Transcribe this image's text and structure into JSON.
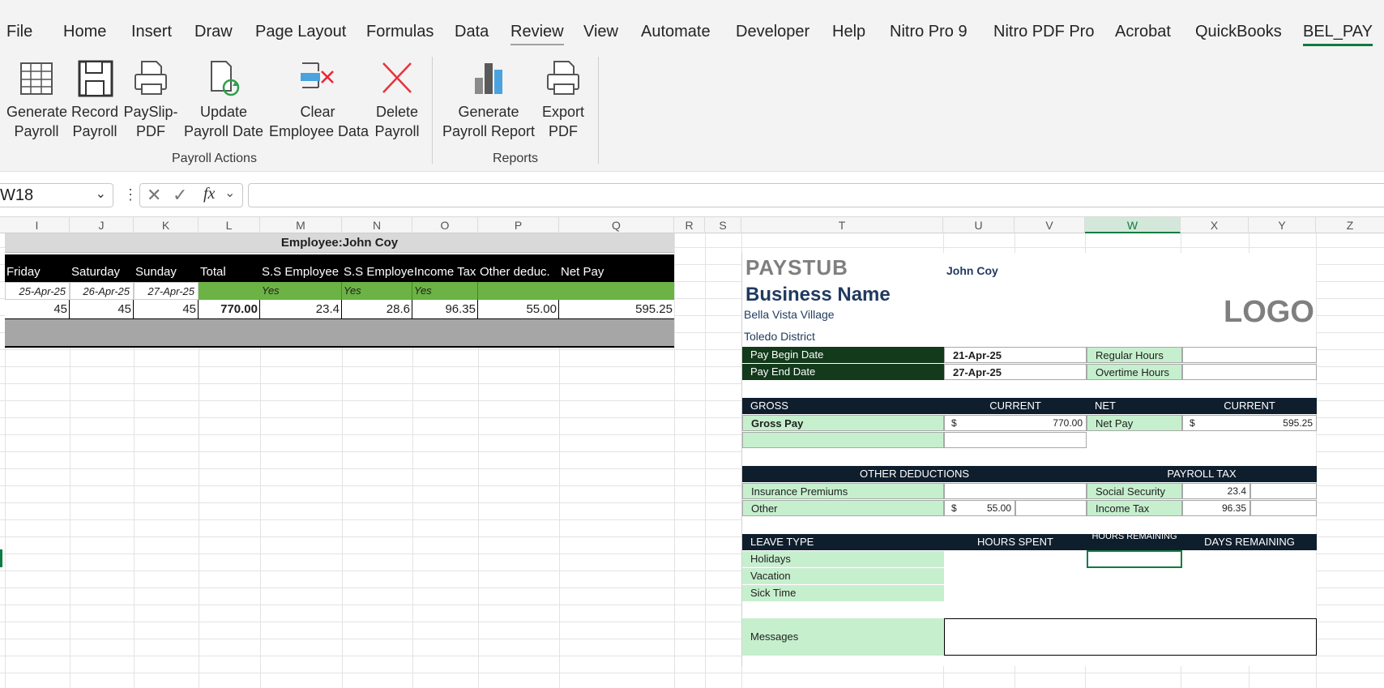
{
  "menu": {
    "items": [
      "File",
      "Home",
      "Insert",
      "Draw",
      "Page Layout",
      "Formulas",
      "Data",
      "Review",
      "View",
      "Automate",
      "Developer",
      "Help",
      "Nitro Pro 9",
      "Nitro PDF Pro",
      "Acrobat",
      "QuickBooks",
      "BEL_PAY"
    ]
  },
  "ribbon": {
    "buttons": [
      {
        "line1": "Generate",
        "line2": "Payroll"
      },
      {
        "line1": "Record",
        "line2": "Payroll"
      },
      {
        "line1": "PaySlip-",
        "line2": "PDF"
      },
      {
        "line1": "Update",
        "line2": "Payroll Date"
      },
      {
        "line1": "Clear",
        "line2": "Employee Data"
      },
      {
        "line1": "Delete",
        "line2": "Payroll"
      },
      {
        "line1": "Generate",
        "line2": "Payroll Report"
      },
      {
        "line1": "Export",
        "line2": "PDF"
      }
    ],
    "groups": [
      "Payroll Actions",
      "Reports"
    ]
  },
  "formula_bar": {
    "name_box": "W18",
    "fx": "fx",
    "formula": ""
  },
  "columns": [
    "I",
    "J",
    "K",
    "L",
    "M",
    "N",
    "O",
    "P",
    "Q",
    "R",
    "S",
    "T",
    "U",
    "V",
    "W",
    "X",
    "Y",
    "Z"
  ],
  "payroll": {
    "employee_title": "Employee:John Coy",
    "headers": [
      "Friday",
      "Saturday",
      "Sunday",
      "Total",
      "S.S Employee",
      "S.S Employer",
      "Income Tax",
      "Other deduc.",
      "Net Pay"
    ],
    "dates": [
      "25-Apr-25",
      "26-Apr-25",
      "27-Apr-25",
      "",
      "Yes",
      "Yes",
      "Yes",
      "",
      ""
    ],
    "values": [
      "45",
      "45",
      "45",
      "770.00",
      "23.4",
      "28.6",
      "96.35",
      "55.00",
      "595.25"
    ]
  },
  "paystub": {
    "title": "PAYSTUB",
    "employee": "John Coy",
    "business": "Business Name",
    "addr1": "Bella Vista Village",
    "addr2": "Toledo District",
    "logo": "LOGO",
    "pay_begin_label": "Pay Begin Date",
    "pay_begin": "21-Apr-25",
    "pay_end_label": "Pay End Date",
    "pay_end": "27-Apr-25",
    "regular_hours": "Regular Hours",
    "overtime_hours": "Overtime Hours",
    "gross": "GROSS",
    "current": "CURRENT",
    "net": "NET",
    "gross_pay_label": "Gross Pay",
    "dollar": "$",
    "gross_pay": "770.00",
    "net_pay_label": "Net Pay",
    "net_pay": "595.25",
    "other_deductions": "OTHER DEDUCTIONS",
    "payroll_tax": "PAYROLL TAX",
    "insurance": "Insurance Premiums",
    "other": "Other",
    "other_amt": "55.00",
    "social_security": "Social Security",
    "social_security_amt": "23.4",
    "income_tax": "Income Tax",
    "income_tax_amt": "96.35",
    "leave_type": "LEAVE TYPE",
    "hours_spent": "HOURS SPENT",
    "hours_remaining": "HOURS REMAINING",
    "days_remaining": "DAYS REMAINING",
    "holidays": "Holidays",
    "vacation": "Vacation",
    "sick_time": "Sick Time",
    "messages": "Messages"
  }
}
